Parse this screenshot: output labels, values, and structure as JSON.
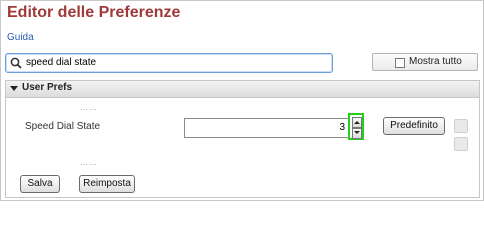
{
  "page": {
    "title": "Editor delle Preferenze",
    "help_link": "Guida"
  },
  "search": {
    "value": "speed dial state",
    "icon": "search-icon"
  },
  "show_all": {
    "label": "Mostra tutto",
    "checked": false
  },
  "section": {
    "title": "User Prefs",
    "ellipsis_top": "……",
    "ellipsis_bottom": "……",
    "preference": {
      "label": "Speed Dial State",
      "value": "3",
      "default_label": "Predefinito"
    }
  },
  "footer": {
    "save_label": "Salva",
    "reset_label": "Reimposta"
  },
  "colors": {
    "title": "#a03a3a",
    "link": "#2a5db0",
    "spinner_highlight": "#22d11a"
  }
}
